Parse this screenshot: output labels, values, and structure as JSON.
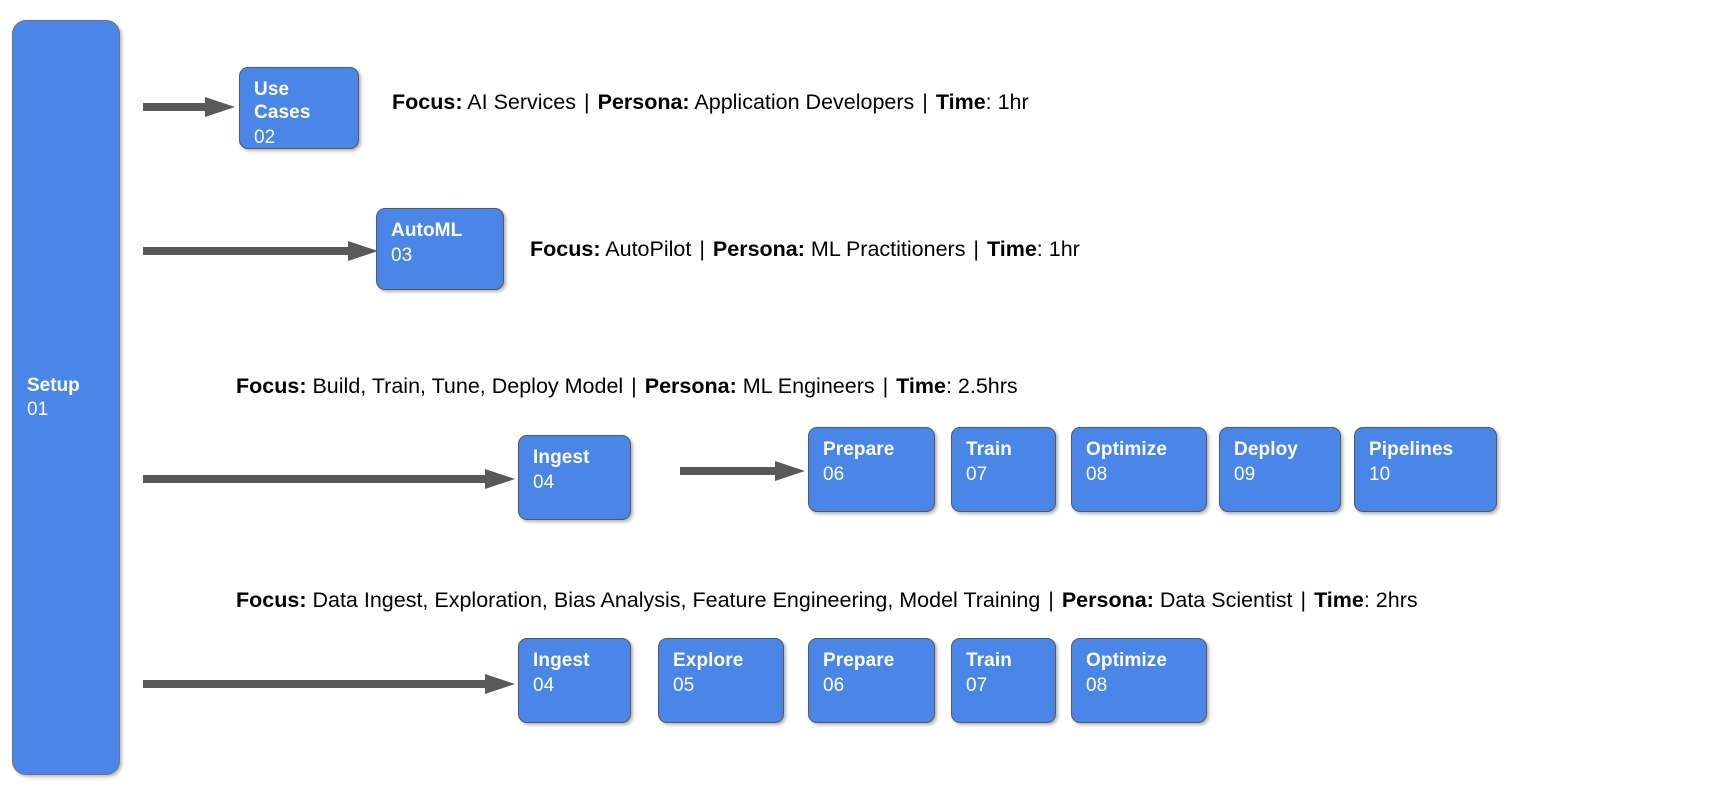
{
  "diagram": {
    "title": "ML Workshop Track Diagram",
    "colors": {
      "node_fill": "#4a86e8",
      "node_border": "#555a5e",
      "arrow": "#595959",
      "text": "#000000",
      "node_text": "#ffffff",
      "background": "#ffffff"
    }
  },
  "rail": {
    "label": "Setup",
    "number": "01"
  },
  "rows": [
    {
      "id": "row-use-cases",
      "caption": {
        "focus_label": "Focus:",
        "focus_value": "AI Services",
        "persona_label": "Persona:",
        "persona_value": "Application Developers",
        "time_label": "Time",
        "time_value": ": 1hr",
        "separator": "|"
      },
      "nodes": [
        {
          "label": "Use\nCases",
          "number": "02"
        }
      ]
    },
    {
      "id": "row-automl",
      "caption": {
        "focus_label": "Focus:",
        "focus_value": "AutoPilot",
        "persona_label": "Persona:",
        "persona_value": "ML Practitioners",
        "time_label": "Time",
        "time_value": ": 1hr",
        "separator": "|"
      },
      "nodes": [
        {
          "label": "AutoML",
          "number": "03"
        }
      ]
    },
    {
      "id": "row-ml-engineers",
      "caption": {
        "focus_label": "Focus:",
        "focus_value": "Build, Train, Tune, Deploy Model ",
        "persona_label": "Persona:",
        "persona_value": "ML Engineers",
        "time_label": "Time",
        "time_value": ": 2.5hrs",
        "separator": "|"
      },
      "nodes": [
        {
          "label": "Ingest",
          "number": "04"
        },
        {
          "label": "Prepare",
          "number": "06"
        },
        {
          "label": "Train",
          "number": "07"
        },
        {
          "label": "Optimize",
          "number": "08"
        },
        {
          "label": "Deploy",
          "number": "09"
        },
        {
          "label": "Pipelines",
          "number": "10"
        }
      ]
    },
    {
      "id": "row-data-scientist",
      "caption": {
        "focus_label": "Focus:",
        "focus_value": "Data Ingest, Exploration, Bias Analysis, Feature Engineering, Model Training ",
        "persona_label": "Persona:",
        "persona_value": "Data Scientist",
        "time_label": "Time",
        "time_value": ": 2hrs",
        "separator": "|"
      },
      "nodes": [
        {
          "label": "Ingest",
          "number": "04"
        },
        {
          "label": "Explore",
          "number": "05"
        },
        {
          "label": "Prepare",
          "number": "06"
        },
        {
          "label": "Train",
          "number": "07"
        },
        {
          "label": "Optimize",
          "number": "08"
        }
      ]
    }
  ]
}
